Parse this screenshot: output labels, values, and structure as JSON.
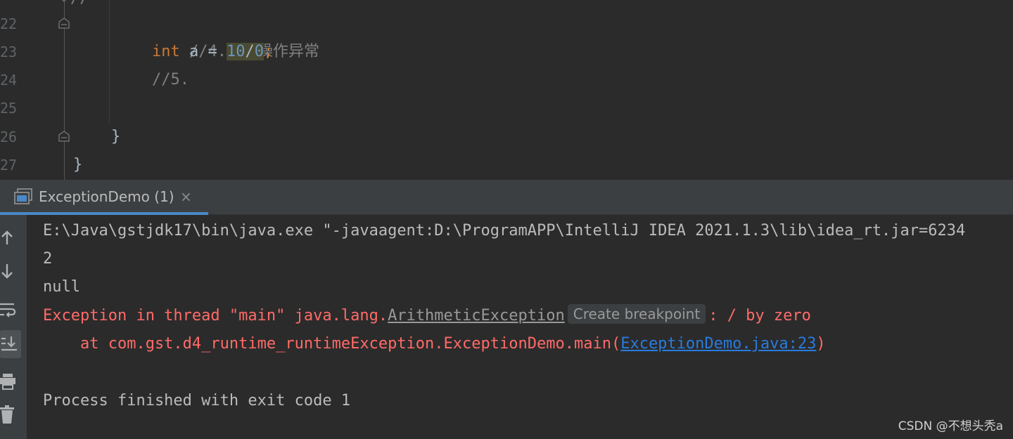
{
  "editor": {
    "lines": [
      {
        "num": "22",
        "text": "//4.数学操作异常"
      },
      {
        "num": "23",
        "kw": "int",
        "var": " a = ",
        "n1": "10",
        "op": "/",
        "n2": "0",
        "semi": ";"
      },
      {
        "num": "24",
        "text": "//5."
      },
      {
        "num": "25"
      },
      {
        "num": "26",
        "text": "}"
      },
      {
        "num": "27",
        "text": "}"
      }
    ]
  },
  "run_tab": {
    "label": "ExceptionDemo (1)",
    "close": "×"
  },
  "console": {
    "cmd": "E:\\Java\\gstjdk17\\bin\\java.exe \"-javaagent:D:\\ProgramAPP\\IntelliJ IDEA 2021.1.3\\lib\\idea_rt.jar=6234",
    "out1": "2",
    "out2": "null",
    "exc_prefix": "Exception in thread \"main\" java.lang.",
    "exc_class": "ArithmeticException",
    "breakpoint_hint": "Create breakpoint",
    "exc_suffix": ": / by zero",
    "trace_prefix": "    at com.gst.d4_runtime_runtimeException.ExceptionDemo.main(",
    "trace_link": "ExceptionDemo.java:23",
    "trace_suffix": ")",
    "finish": "Process finished with exit code 1"
  },
  "toolbar_icons": [
    "arrow-up-icon",
    "arrow-down-icon",
    "soft-wrap-icon",
    "scroll-to-end-icon",
    "print-icon",
    "trash-icon"
  ],
  "watermark": "CSDN @不想头秃a",
  "colors": {
    "background": "#2b2b2b",
    "keyword": "#cc7832",
    "number": "#6897bb",
    "comment": "#808080",
    "error": "#ff6b68",
    "link": "#287bde",
    "tab_underline": "#4a88c7"
  }
}
